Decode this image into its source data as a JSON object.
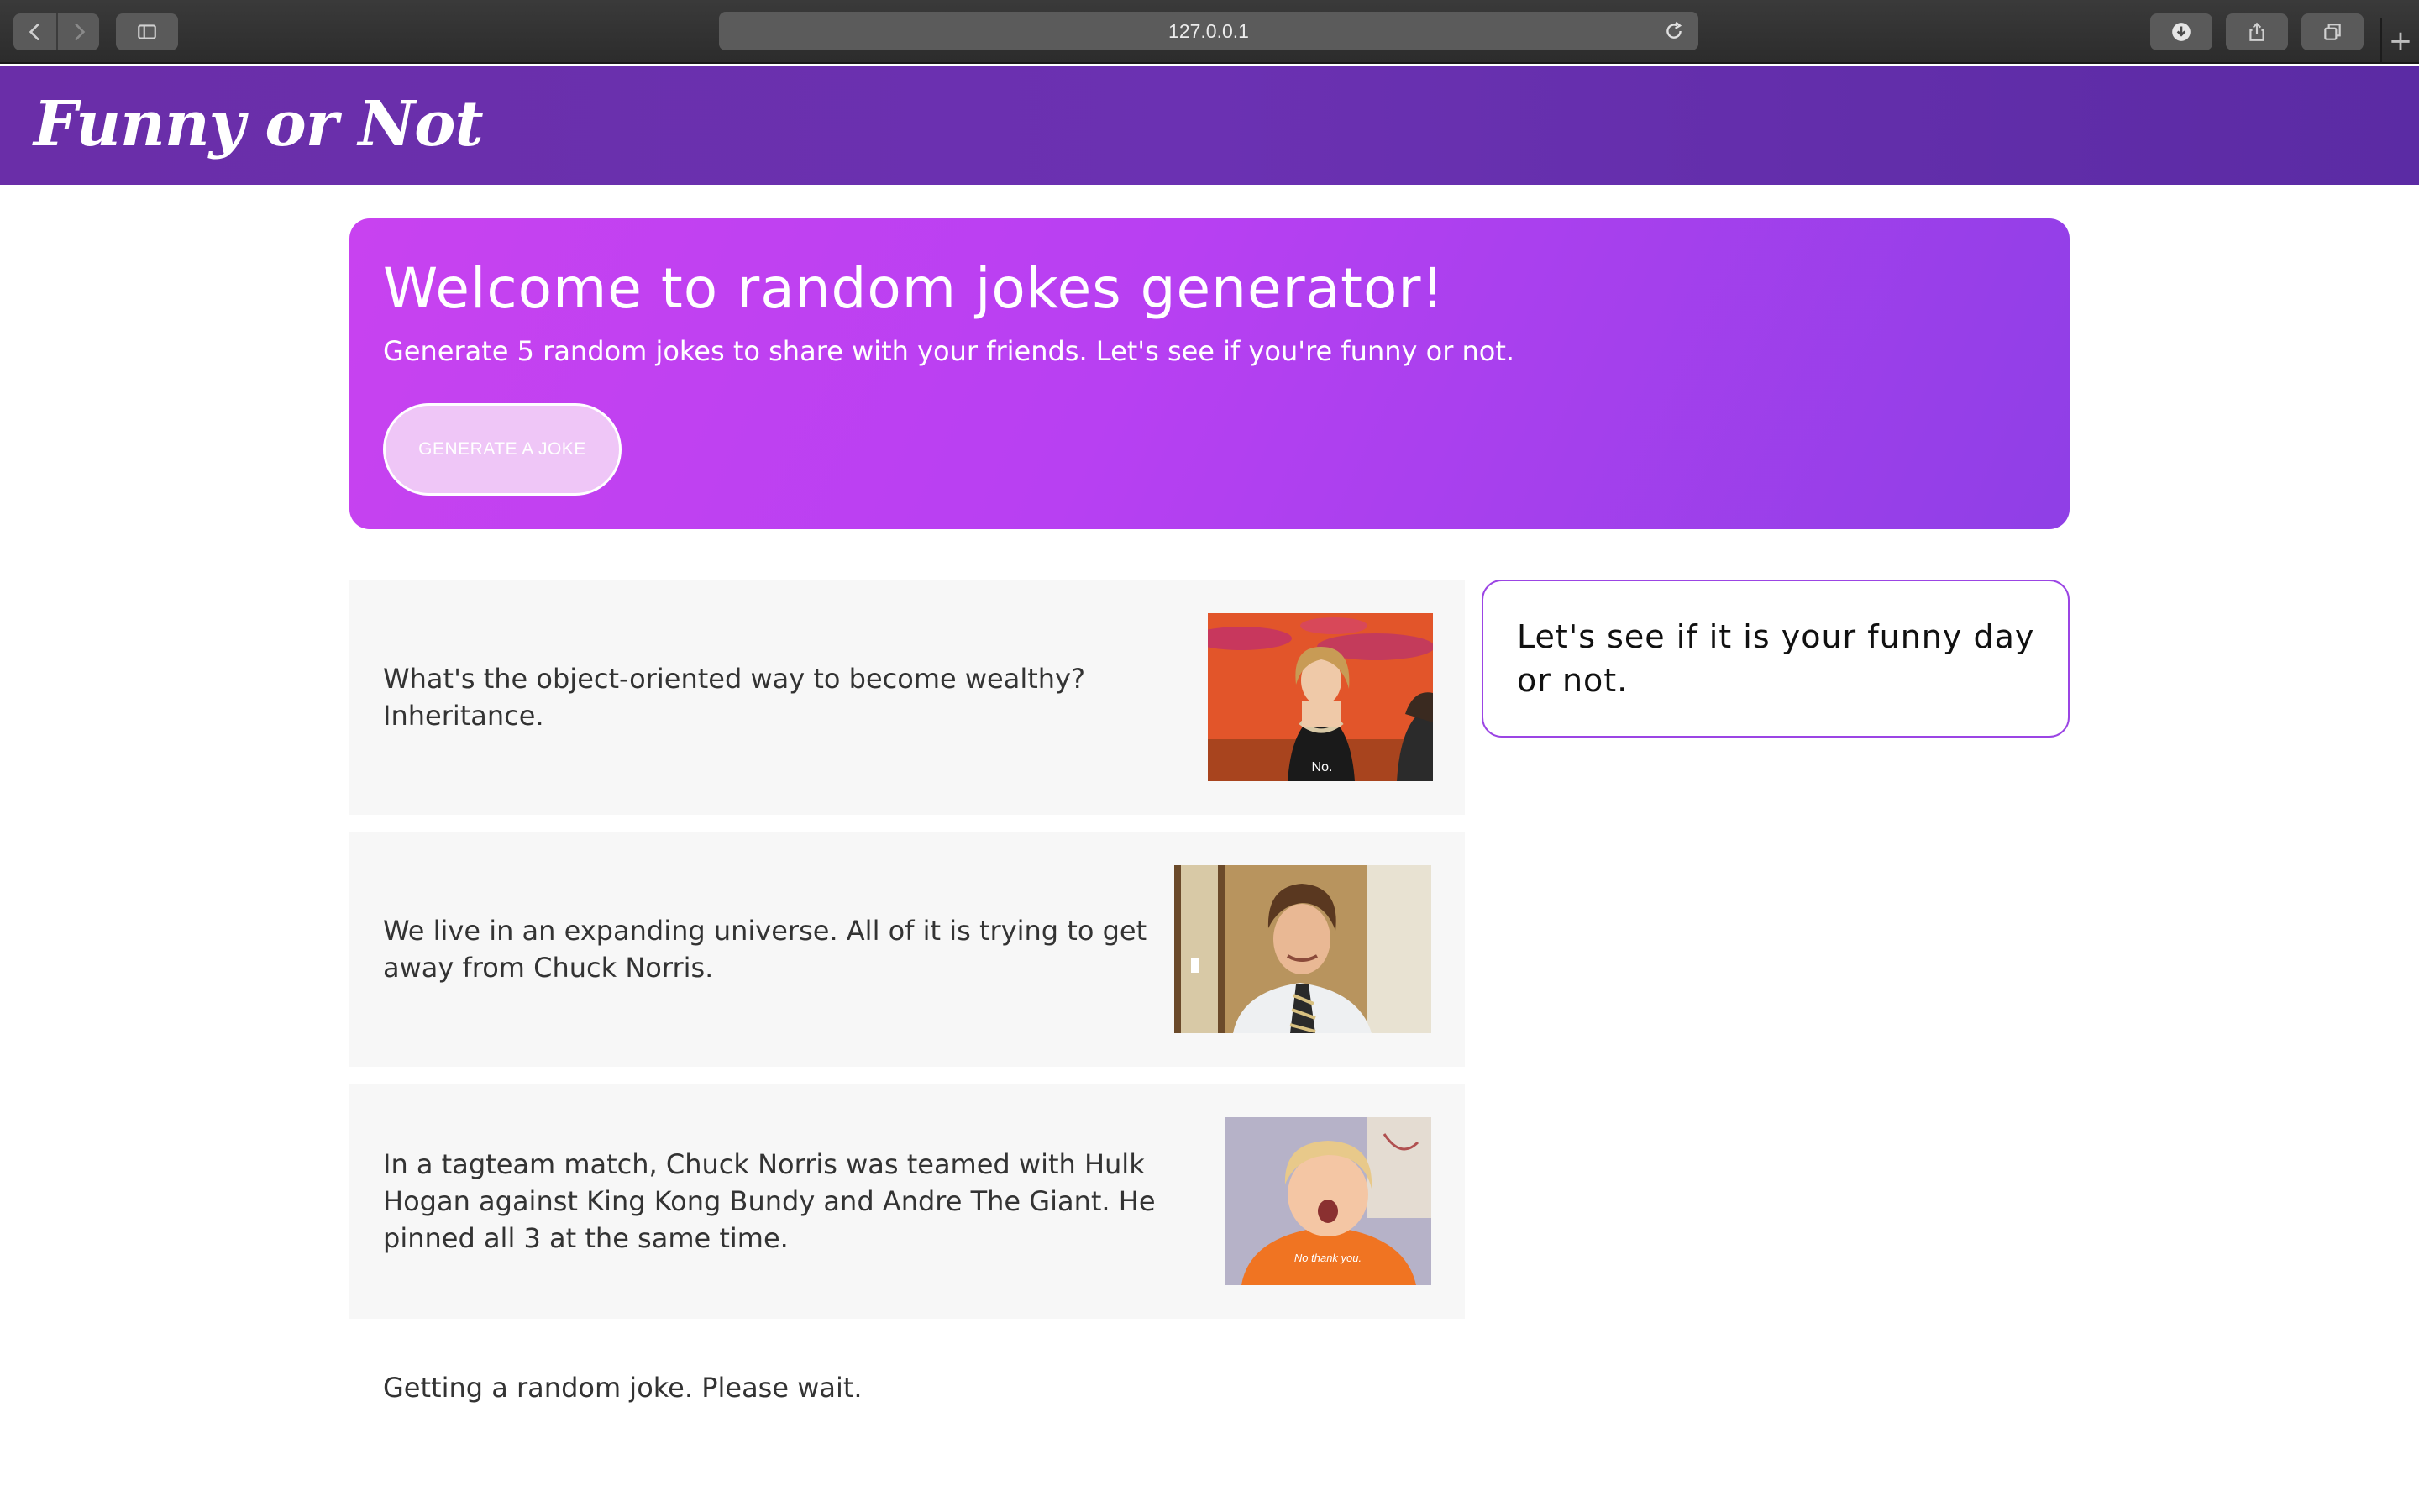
{
  "browser": {
    "url": "127.0.0.1",
    "icons": [
      "back-icon",
      "forward-icon",
      "sidebar-icon",
      "reload-icon",
      "download-icon",
      "share-icon",
      "tabs-icon",
      "plus-icon"
    ],
    "new_tab_glyph": "+"
  },
  "app": {
    "brand": "Funny or Not",
    "header_color": "#6a2ea8"
  },
  "hero": {
    "title": "Welcome to random jokes generator!",
    "subtitle": "Generate 5 random jokes to share with your friends. Let's see if you're funny or not.",
    "button_label": "GENERATE A JOKE",
    "gradient": [
      "#c842f0",
      "#8f3fe6"
    ]
  },
  "jokes": [
    {
      "text": "What's the object-oriented way to become wealthy? Inheritance.",
      "gif_caption": "No."
    },
    {
      "text": "We live in an expanding universe. All of it is trying to get away from Chuck Norris.",
      "gif_caption": ""
    },
    {
      "text": "In a tagteam match, Chuck Norris was teamed with Hulk Hogan against King Kong Bundy and Andre The Giant. He pinned all 3 at the same time.",
      "gif_caption": "No thank you."
    }
  ],
  "loading_text": "Getting a random joke. Please wait.",
  "side": {
    "message": "Let's see if it is your funny day or not.",
    "border_color": "#9b45e4"
  }
}
